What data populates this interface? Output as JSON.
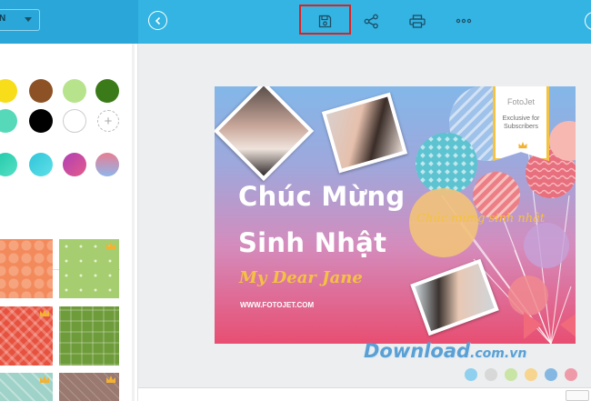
{
  "toolbar": {
    "dropdown_text": "N",
    "buttons": [
      "back-icon",
      "save-icon",
      "share-icon",
      "print-icon",
      "more-icon"
    ]
  },
  "left_panel": {
    "color_swatches": [
      "#f7dd1a",
      "#8c5225",
      "#b7e38d",
      "#3b7a18",
      "#55d9b9",
      "#000000",
      "#ffffff",
      "add"
    ],
    "gradient_swatches": [
      "#1fc8a8→#57e0c6",
      "#2fc5d9→#60e0e8",
      "#b03fb5→#e45b8a",
      "#e87e93→#8fb5ea"
    ],
    "pattern_tiles": [
      "orange-dots",
      "green-dots",
      "red-weave",
      "green-plaid",
      "teal-diamond",
      "brown-grid"
    ]
  },
  "card": {
    "title_line1": "Chúc Mừng",
    "title_line2": "Sinh Nhật",
    "subtitle": "My Dear Jane",
    "url": "WWW.FOTOJET.COM",
    "script_text": "Chúc mừng sinh nhật",
    "badge_logo": "FotoJet",
    "badge_text": "Exclusive for Subscribers"
  },
  "status": {
    "zoom": "",
    "pages": ""
  },
  "watermark": {
    "text": "Download",
    "domain": ".com.vn",
    "dots": [
      "#8fd0ef",
      "#d8d8d8",
      "#c9e5a5",
      "#f7d58e",
      "#84b8e2",
      "#ef9aa9"
    ]
  },
  "colors": {
    "accent": "#34b4e2",
    "highlight": "#e02020"
  }
}
